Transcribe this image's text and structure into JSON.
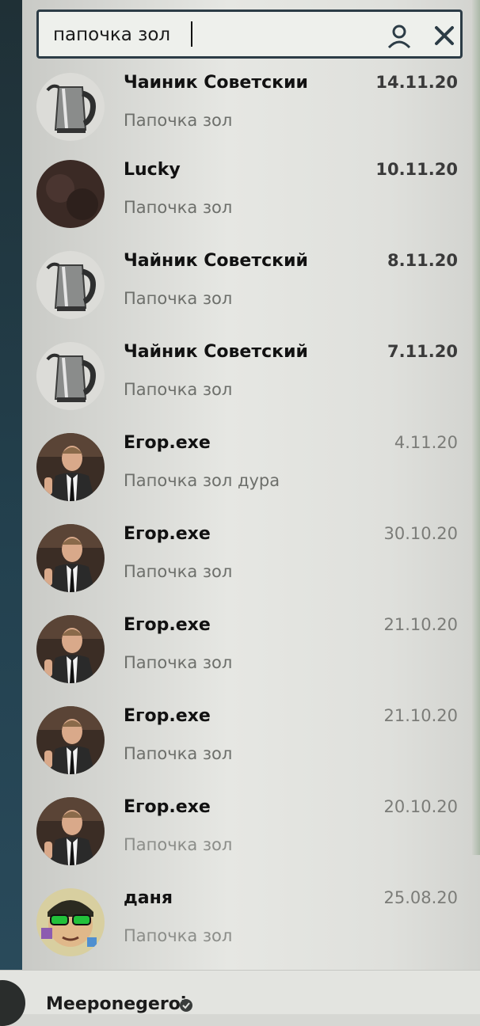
{
  "search": {
    "value": "папочка зол",
    "clear_icon": "close-icon",
    "contacts_icon": "person-icon"
  },
  "results": [
    {
      "name": "Чаиник Советскии",
      "date": "14.11.20",
      "preview": "Папочка зол",
      "avatar": "kettle"
    },
    {
      "name": "Lucky",
      "date": "10.11.20",
      "preview": "Папочка зол",
      "avatar": "dark"
    },
    {
      "name": "Чайник Советский",
      "date": "8.11.20",
      "preview": "Папочка зол",
      "avatar": "kettle"
    },
    {
      "name": "Чайник Советский",
      "date": "7.11.20",
      "preview": "Папочка зол",
      "avatar": "kettle"
    },
    {
      "name": "Егор.exe",
      "date": "4.11.20",
      "preview": "Папочка зол дура",
      "avatar": "man"
    },
    {
      "name": "Егор.exe",
      "date": "30.10.20",
      "preview": "Папочка зол",
      "avatar": "man"
    },
    {
      "name": "Егор.exe",
      "date": "21.10.20",
      "preview": "Папочка зол",
      "avatar": "man"
    },
    {
      "name": "Егор.exe",
      "date": "21.10.20",
      "preview": "Папочка зол",
      "avatar": "man"
    },
    {
      "name": "Егор.exe",
      "date": "20.10.20",
      "preview": "Папочка зол",
      "avatar": "man"
    },
    {
      "name": "даня",
      "date": "25.08.20",
      "preview": "Папочка зол",
      "avatar": "sunglasses"
    }
  ],
  "account": {
    "name": "Meeponegeroi",
    "badge_icon": "verified-icon"
  },
  "colors": {
    "sidebar": "#23414f",
    "panel": "#e6e7e3",
    "search_border": "#2c3c46"
  }
}
